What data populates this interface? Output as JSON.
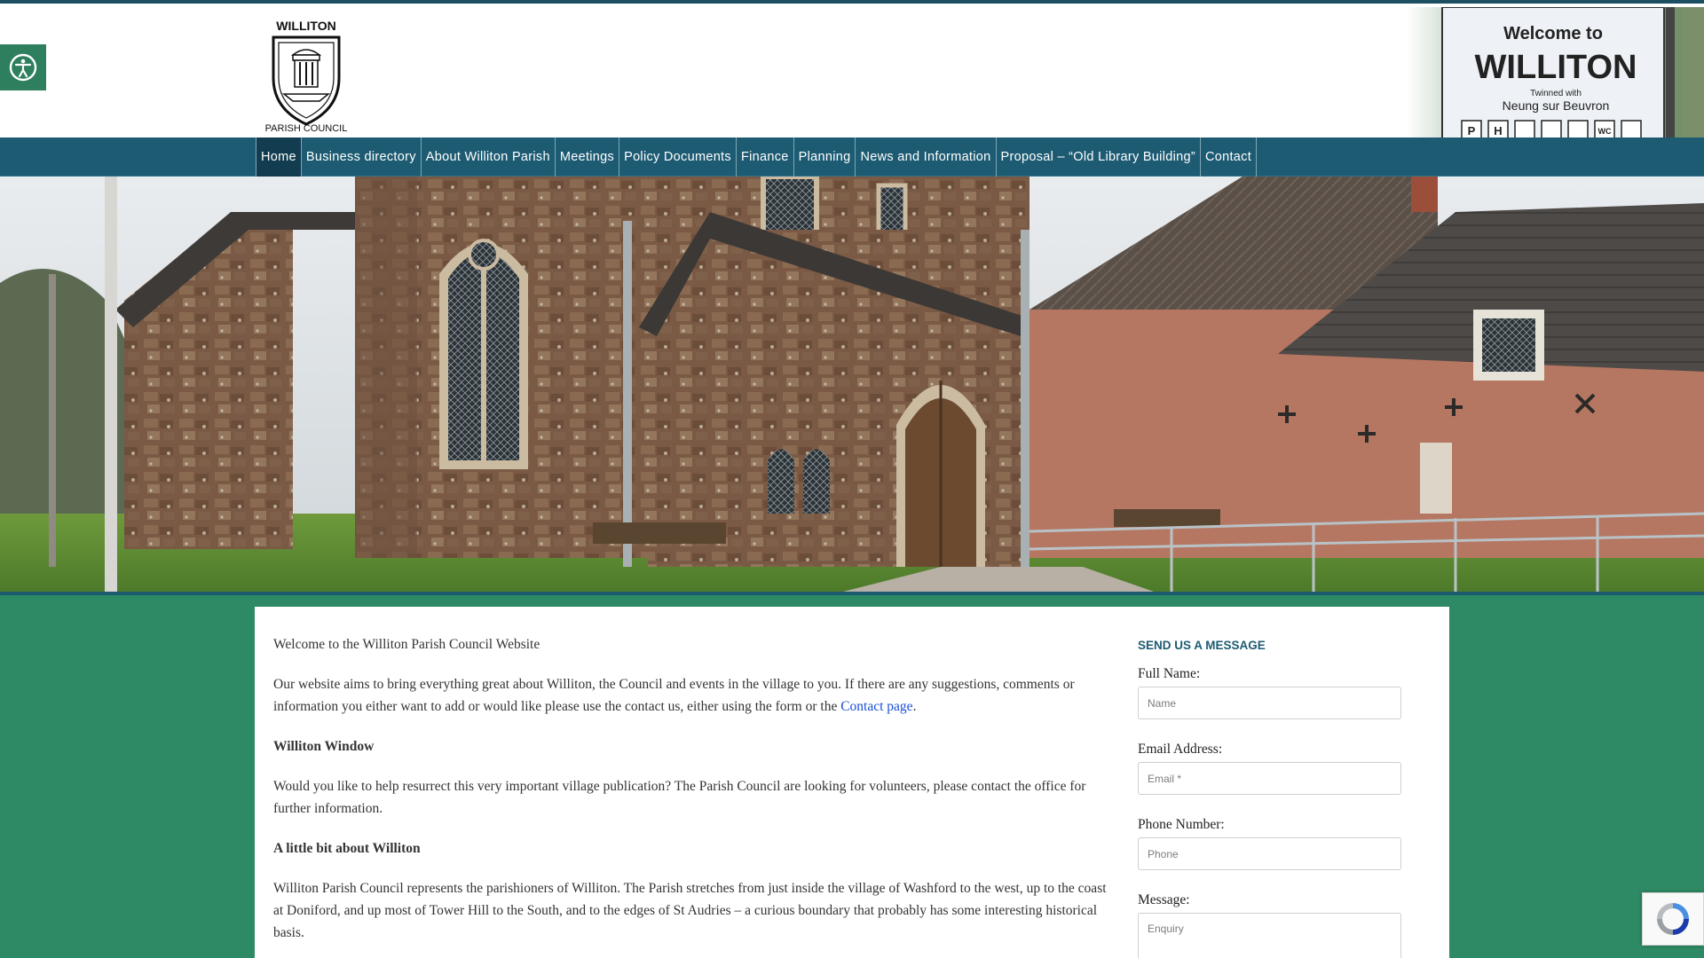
{
  "header": {
    "logo_text_top": "WILLITON",
    "logo_text_bottom": "PARISH COUNCIL",
    "sign": {
      "line1": "Welcome to",
      "line2": "WILLITON",
      "line3": "Twinned with",
      "line4": "Neung sur Beuvron"
    }
  },
  "nav": {
    "items": [
      {
        "label": "Home"
      },
      {
        "label": "Business directory"
      },
      {
        "label": "About Williton Parish"
      },
      {
        "label": "Meetings"
      },
      {
        "label": "Policy Documents"
      },
      {
        "label": "Finance"
      },
      {
        "label": "Planning"
      },
      {
        "label": "News and Information"
      },
      {
        "label": "Proposal – “Old Library Building”"
      },
      {
        "label": "Contact"
      }
    ]
  },
  "main": {
    "welcome": "Welcome to the Williton Parish Council Website",
    "intro_text": "Our website aims to bring everything great about Williton, the Council and events in the village to you. If there are any suggestions, comments or information you either want to add or would like please use the contact us, either using the form or the ",
    "intro_link": "Contact page",
    "intro_end": ".",
    "window_heading": "Williton Window",
    "window_text": "Would you like to help resurrect this very important village publication?  The Parish Council are looking for volunteers, please contact the office for further information.",
    "about_heading": "A little bit about Williton",
    "about_text": "Williton Parish Council represents the parishioners of Williton. The Parish stretches from just inside the village of Washford to the west, up to the coast at Doniford, and up most of Tower Hill to the South, and to the edges of St Audries – a curious boundary that probably has some interesting historical basis."
  },
  "form": {
    "title": "SEND US A MESSAGE",
    "name_label": "Full Name:",
    "name_placeholder": "Name",
    "email_label": "Email Address:",
    "email_placeholder": "Email *",
    "phone_label": "Phone Number:",
    "phone_placeholder": "Phone",
    "message_label": "Message:",
    "message_placeholder": "Enquiry"
  },
  "colors": {
    "background": "#2e8a64",
    "nav": "#1d5b73",
    "nav_active": "#123c4f",
    "heading": "#1d5b73"
  }
}
